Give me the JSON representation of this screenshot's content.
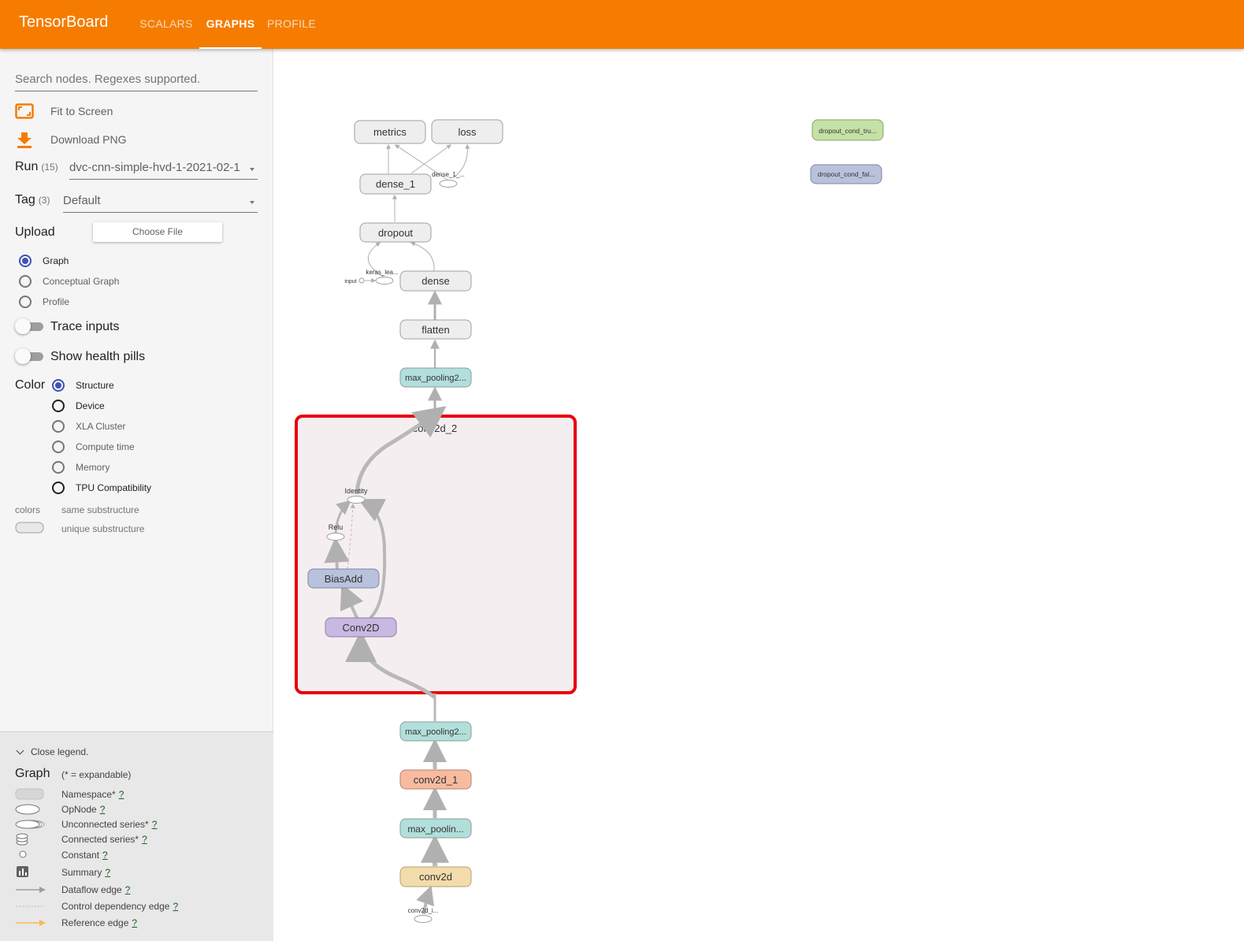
{
  "header": {
    "brand": "TensorBoard",
    "tabs": [
      {
        "label": "SCALARS",
        "active": false
      },
      {
        "label": "GRAPHS",
        "active": true
      },
      {
        "label": "PROFILE",
        "active": false
      }
    ],
    "bar_color": "#f57c00"
  },
  "sidebar": {
    "search_placeholder": "Search nodes. Regexes supported.",
    "fit_to_screen": "Fit to Screen",
    "download_png": "Download PNG",
    "run": {
      "label": "Run",
      "count": "(15)",
      "value": "dvc-cnn-simple-hvd-1-2021-02-1"
    },
    "tag": {
      "label": "Tag",
      "count": "(3)",
      "value": "Default"
    },
    "upload": {
      "label": "Upload",
      "button": "Choose File"
    },
    "graph_type": [
      {
        "label": "Graph",
        "selected": true
      },
      {
        "label": "Conceptual Graph",
        "selected": false
      },
      {
        "label": "Profile",
        "selected": false
      }
    ],
    "trace_inputs": "Trace inputs",
    "show_health_pills": "Show health pills",
    "color": {
      "label": "Color",
      "options": [
        {
          "label": "Structure",
          "selected": true
        },
        {
          "label": "Device",
          "selected": false
        },
        {
          "label": "XLA Cluster",
          "selected": false
        },
        {
          "label": "Compute time",
          "selected": false
        },
        {
          "label": "Memory",
          "selected": false
        },
        {
          "label": "TPU Compatibility",
          "selected": false
        }
      ]
    },
    "colors_label": "colors",
    "same_substructure": "same substructure",
    "unique_substructure": "unique substructure"
  },
  "legend": {
    "close": "Close legend.",
    "title": "Graph",
    "subtitle": "(* = expandable)",
    "items": [
      {
        "label": "Namespace*",
        "help": "?"
      },
      {
        "label": "OpNode",
        "help": "?"
      },
      {
        "label": "Unconnected series*",
        "help": "?"
      },
      {
        "label": "Connected series*",
        "help": "?"
      },
      {
        "label": "Constant",
        "help": "?"
      },
      {
        "label": "Summary",
        "help": "?"
      },
      {
        "label": "Dataflow edge",
        "help": "?"
      },
      {
        "label": "Control dependency edge",
        "help": "?"
      },
      {
        "label": "Reference edge",
        "help": "?"
      }
    ]
  },
  "graph": {
    "nodes": {
      "metrics": "metrics",
      "loss": "loss",
      "dense_1": "dense_1",
      "dense_1_small": "dense_1_...",
      "dropout": "dropout",
      "keras_lea": "keras_lea...",
      "input": "input",
      "dense": "dense",
      "flatten": "flatten",
      "max_pooling_top": "max_pooling2...",
      "conv2d_2": "conv2d_2",
      "identity": "Identity",
      "relu": "Relu",
      "biasadd": "BiasAdd",
      "conv2d_op": "Conv2D",
      "max_pooling_mid": "max_pooling2...",
      "conv2d_1": "conv2d_1",
      "max_pooling_low": "max_poolin...",
      "conv2d": "conv2d",
      "conv2d_input": "conv2d_i...",
      "dropout_cond_true": "dropout_cond_tru...",
      "dropout_cond_false": "dropout_cond_fal..."
    },
    "colors": {
      "namespace": "#eeeeee",
      "maxpool": "#b2dfdb",
      "conv2d_1": "#f8bba0",
      "conv2d": "#f3dcab",
      "biasadd": "#b9c2dc",
      "conv2d_op": "#c9b8e2",
      "cond_true": "#c5e1a5",
      "cond_false": "#b9c2dc",
      "selection": "#e8000d"
    }
  }
}
